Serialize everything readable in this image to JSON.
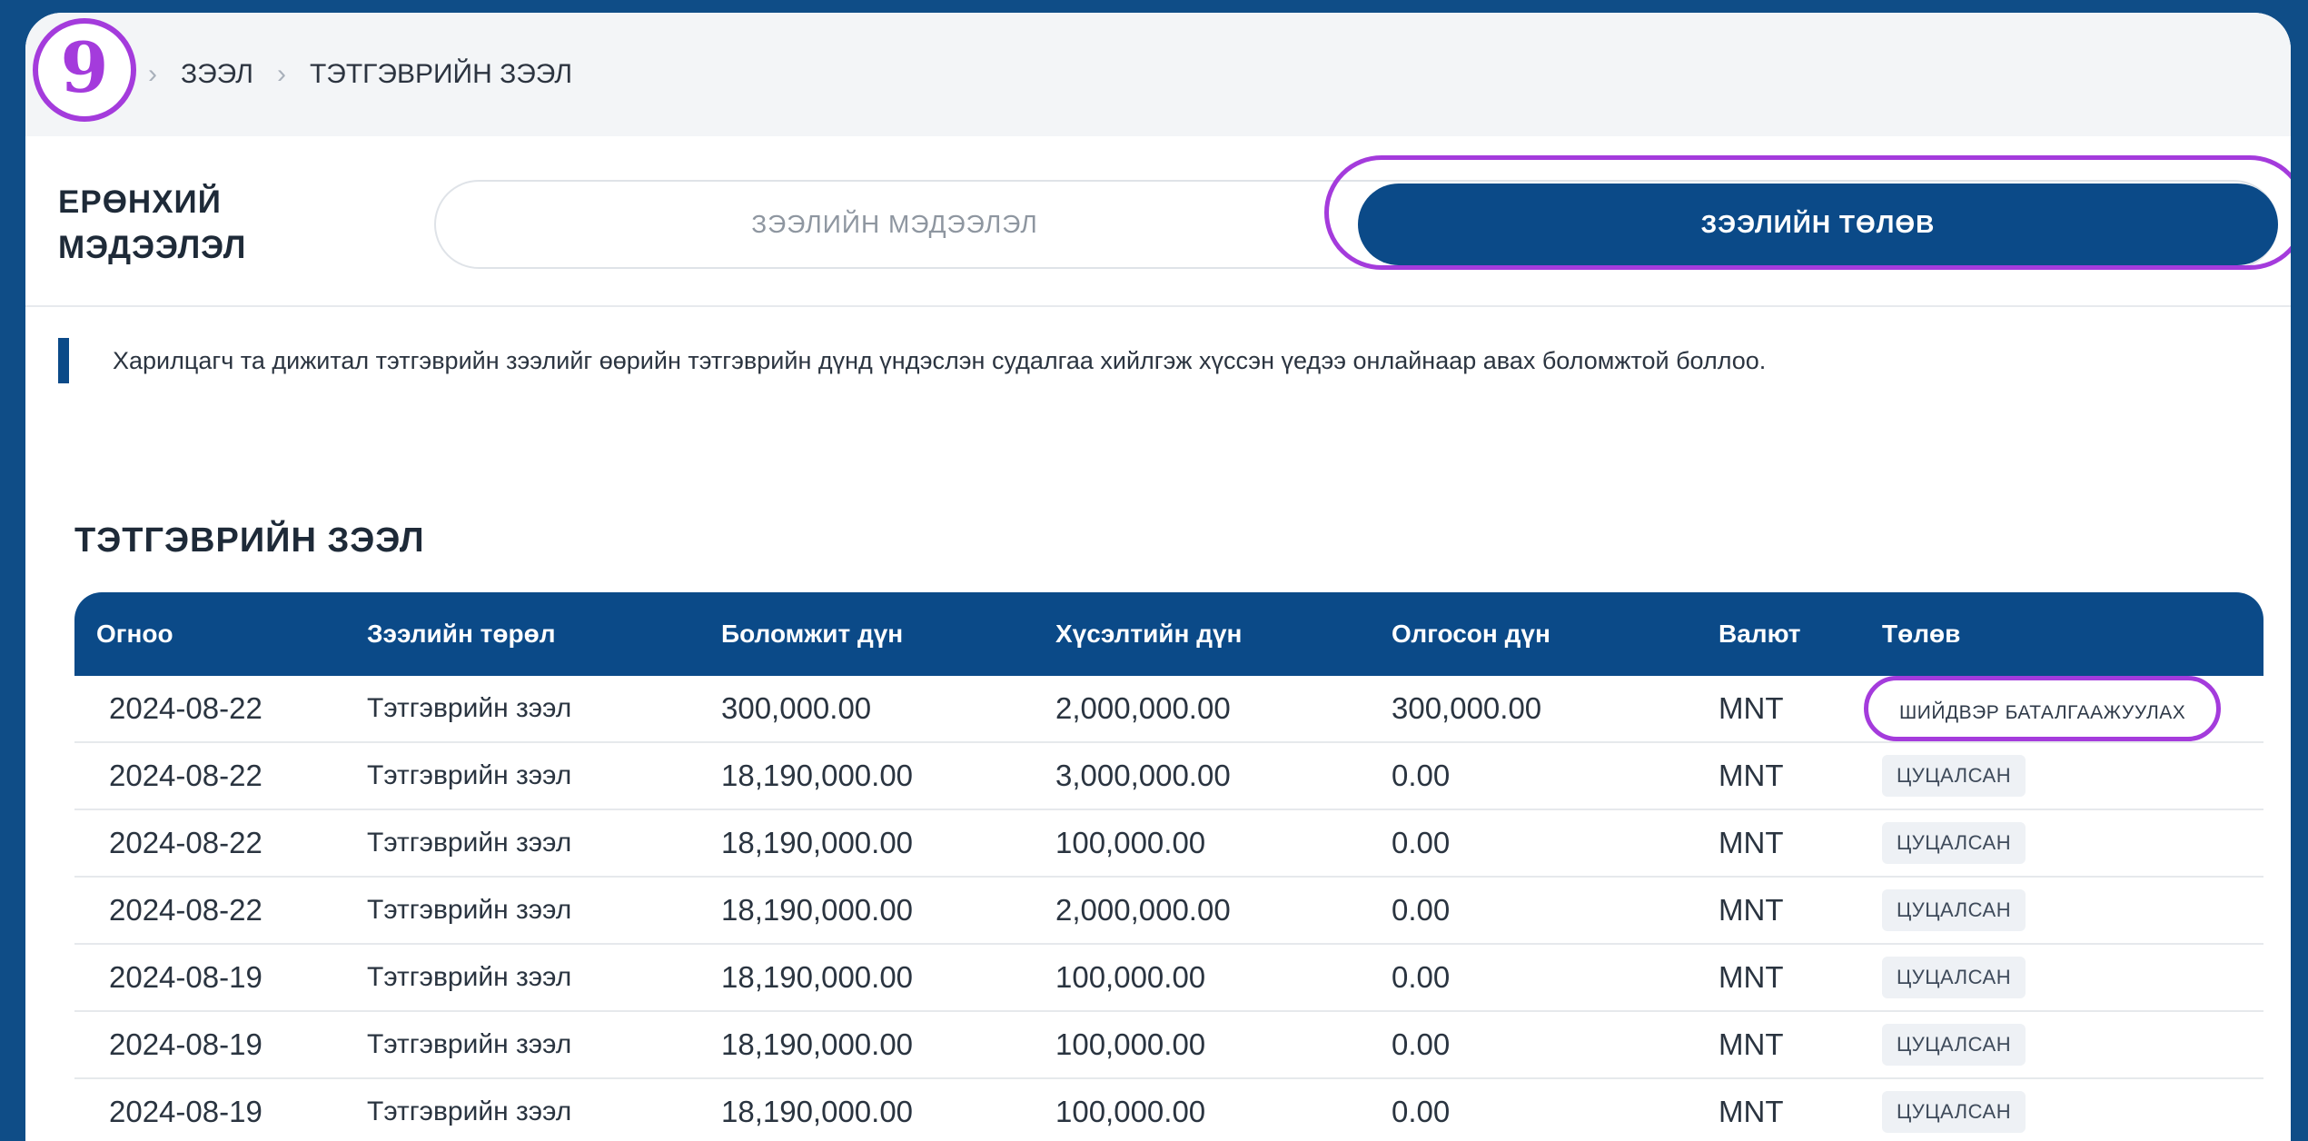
{
  "step": "9",
  "breadcrumb": {
    "items": [
      "ЗЭЭЛ",
      "ТЭТГЭВРИЙН ЗЭЭЛ"
    ]
  },
  "header": {
    "title_line1": "ЕРӨНХИЙ",
    "title_line2": "МЭДЭЭЛЭЛ"
  },
  "tabs": [
    {
      "label": "ЗЭЭЛИЙН МЭДЭЭЛЭЛ",
      "active": false
    },
    {
      "label": "ЗЭЭЛИЙН ТӨЛӨВ",
      "active": true
    }
  ],
  "notice": "Харилцагч та дижитал тэтгэврийн зээлийг өөрийн тэтгэврийн дүнд үндэслэн судалгаа хийлгэж хүссэн үедээ онлайнаар авах боломжтой боллоо.",
  "table": {
    "title": "ТЭТГЭВРИЙН ЗЭЭЛ",
    "headers": [
      "Огноо",
      "Зээлийн төрөл",
      "Боломжит дүн",
      "Хүсэлтийн дүн",
      "Олгосон дүн",
      "Валют",
      "Төлөв"
    ],
    "rows": [
      [
        "2024-08-22",
        "Тэтгэврийн зээл",
        "300,000.00",
        "2,000,000.00",
        "300,000.00",
        "MNT",
        "ШИЙДВЭР БАТАЛГААЖУУЛАХ"
      ],
      [
        "2024-08-22",
        "Тэтгэврийн зээл",
        "18,190,000.00",
        "3,000,000.00",
        "0.00",
        "MNT",
        "ЦУЦАЛСАН"
      ],
      [
        "2024-08-22",
        "Тэтгэврийн зээл",
        "18,190,000.00",
        "100,000.00",
        "0.00",
        "MNT",
        "ЦУЦАЛСАН"
      ],
      [
        "2024-08-22",
        "Тэтгэврийн зээл",
        "18,190,000.00",
        "2,000,000.00",
        "0.00",
        "MNT",
        "ЦУЦАЛСАН"
      ],
      [
        "2024-08-19",
        "Тэтгэврийн зээл",
        "18,190,000.00",
        "100,000.00",
        "0.00",
        "MNT",
        "ЦУЦАЛСАН"
      ],
      [
        "2024-08-19",
        "Тэтгэврийн зээл",
        "18,190,000.00",
        "100,000.00",
        "0.00",
        "MNT",
        "ЦУЦАЛСАН"
      ],
      [
        "2024-08-19",
        "Тэтгэврийн зээл",
        "18,190,000.00",
        "100,000.00",
        "0.00",
        "MNT",
        "ЦУЦАЛСАН"
      ]
    ]
  },
  "colors": {
    "background": "#0f4d87",
    "primary": "#0b4a88",
    "highlight": "#a43bdc"
  }
}
